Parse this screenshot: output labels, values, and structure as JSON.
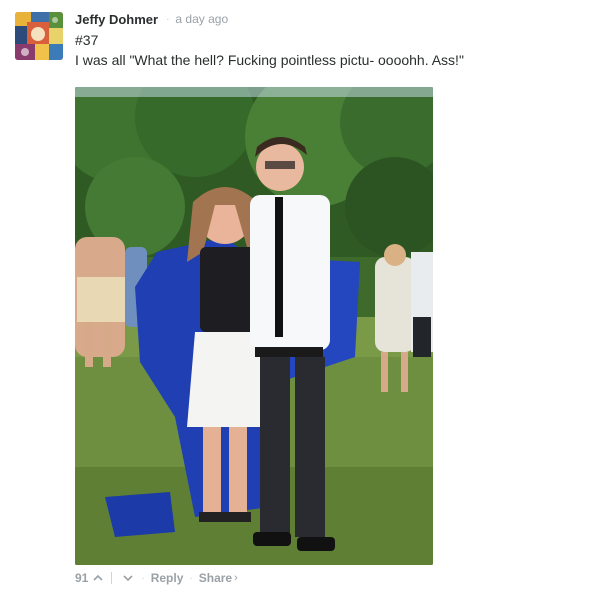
{
  "comment": {
    "author": "Jeffy Dohmer",
    "separator": "·",
    "timestamp": "a day ago",
    "lines": [
      "#37",
      "I was all \"What the hell? Fucking pointless pictu- oooohh. Ass!\""
    ],
    "photo_icon": "photo-image",
    "footer": {
      "vote_count": "91",
      "upvote_icon": "chevron-up-icon",
      "downvote_icon": "chevron-down-icon",
      "reply_label": "Reply",
      "share_label": "Share",
      "share_icon": "chevron-right-icon",
      "dot": "·"
    }
  },
  "colors": {
    "text": "#2a2e2e",
    "muted": "#9aa1a6",
    "gown_blue": "#1f3fb3"
  }
}
